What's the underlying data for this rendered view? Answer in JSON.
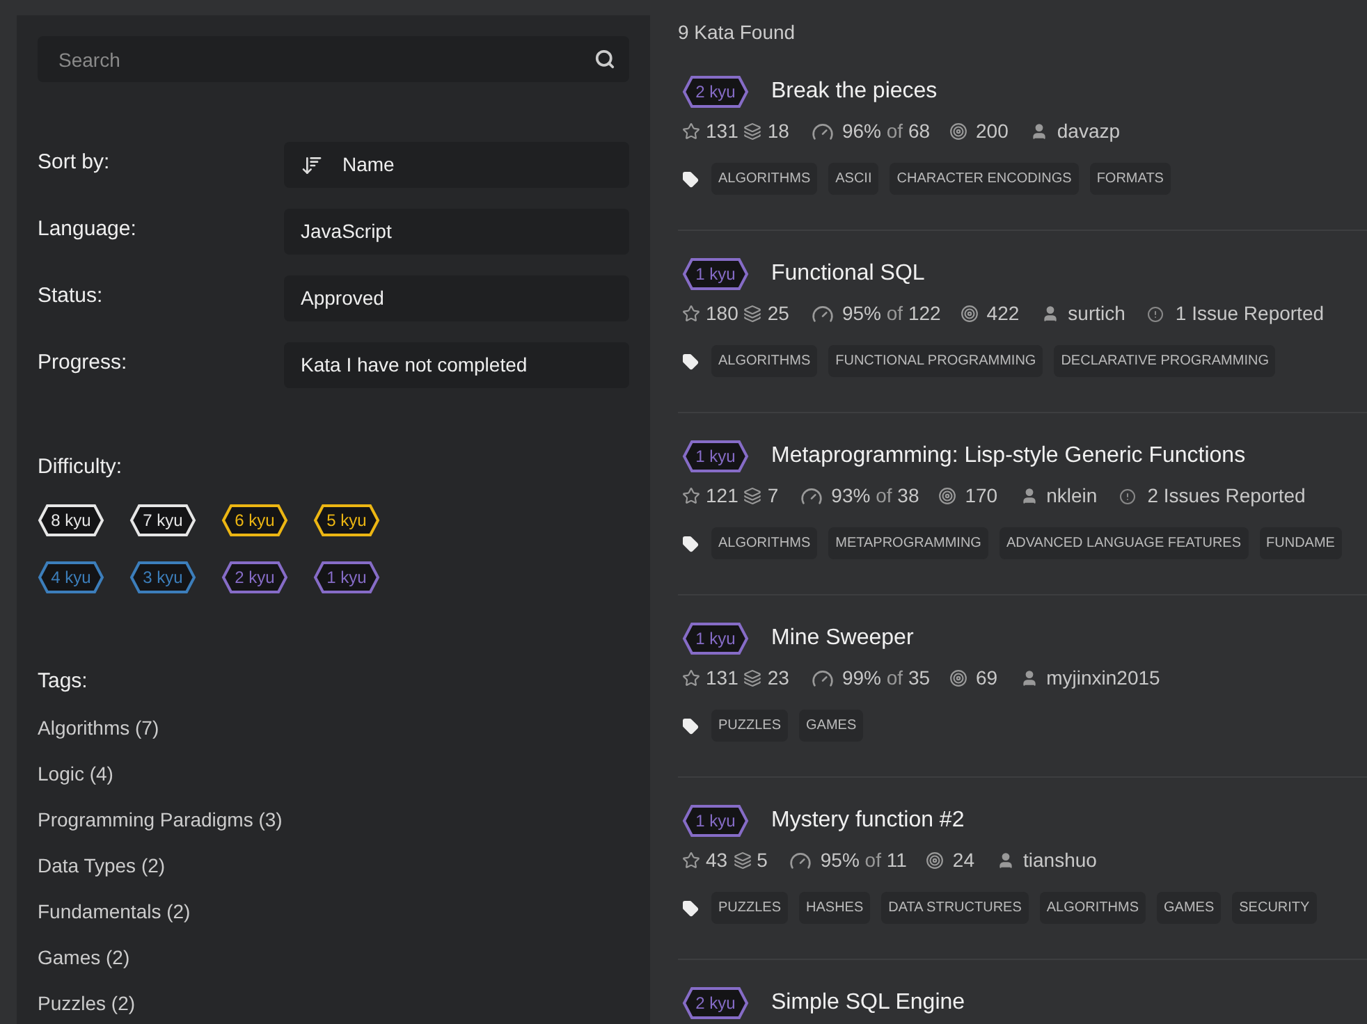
{
  "sidebar": {
    "search": {
      "placeholder": "Search"
    },
    "filters": [
      {
        "label": "Sort by:",
        "value": "Name",
        "kind": "sort"
      },
      {
        "label": "Language:",
        "value": "JavaScript",
        "kind": "select"
      },
      {
        "label": "Status:",
        "value": "Approved",
        "kind": "select"
      },
      {
        "label": "Progress:",
        "value": "Kata I have not completed",
        "kind": "select"
      }
    ],
    "difficulty": {
      "label": "Difficulty:",
      "ranks": [
        {
          "label": "8 kyu",
          "color": "#e6e6e6"
        },
        {
          "label": "7 kyu",
          "color": "#e6e6e6"
        },
        {
          "label": "6 kyu",
          "color": "#ecb613"
        },
        {
          "label": "5 kyu",
          "color": "#ecb613"
        },
        {
          "label": "4 kyu",
          "color": "#3c7ebb"
        },
        {
          "label": "3 kyu",
          "color": "#3c7ebb"
        },
        {
          "label": "2 kyu",
          "color": "#866cc7"
        },
        {
          "label": "1 kyu",
          "color": "#866cc7"
        }
      ]
    },
    "tags": {
      "label": "Tags:",
      "items": [
        "Algorithms (7)",
        "Logic (4)",
        "Programming Paradigms (3)",
        "Data Types (2)",
        "Fundamentals (2)",
        "Games (2)",
        "Puzzles (2)"
      ]
    }
  },
  "results": {
    "count": "9 Kata Found",
    "katas": [
      {
        "rank": "2 kyu",
        "color": "#866cc7",
        "title": "Break the pieces",
        "stars": "131",
        "collections": "18",
        "satisfaction": "96%",
        "of": "of",
        "votes": "68",
        "completions": "200",
        "author": "davazp",
        "tags": [
          "ALGORITHMS",
          "ASCII",
          "CHARACTER ENCODINGS",
          "FORMATS"
        ]
      },
      {
        "rank": "1 kyu",
        "color": "#866cc7",
        "title": "Functional SQL",
        "stars": "180",
        "collections": "25",
        "satisfaction": "95%",
        "of": "of",
        "votes": "122",
        "completions": "422",
        "author": "surtich",
        "issues": "1 Issue Reported",
        "tags": [
          "ALGORITHMS",
          "FUNCTIONAL PROGRAMMING",
          "DECLARATIVE PROGRAMMING"
        ]
      },
      {
        "rank": "1 kyu",
        "color": "#866cc7",
        "title": "Metaprogramming: Lisp-style Generic Functions",
        "stars": "121",
        "collections": "7",
        "satisfaction": "93%",
        "of": "of",
        "votes": "38",
        "completions": "170",
        "author": "nklein",
        "issues": "2 Issues Reported",
        "tags": [
          "ALGORITHMS",
          "METAPROGRAMMING",
          "ADVANCED LANGUAGE FEATURES",
          "FUNDAME"
        ]
      },
      {
        "rank": "1 kyu",
        "color": "#866cc7",
        "title": "Mine Sweeper",
        "stars": "131",
        "collections": "23",
        "satisfaction": "99%",
        "of": "of",
        "votes": "35",
        "completions": "69",
        "author": "myjinxin2015",
        "tags": [
          "PUZZLES",
          "GAMES"
        ]
      },
      {
        "rank": "1 kyu",
        "color": "#866cc7",
        "title": "Mystery function #2",
        "stars": "43",
        "collections": "5",
        "satisfaction": "95%",
        "of": "of",
        "votes": "11",
        "completions": "24",
        "author": "tianshuo",
        "tags": [
          "PUZZLES",
          "HASHES",
          "DATA STRUCTURES",
          "ALGORITHMS",
          "GAMES",
          "SECURITY"
        ]
      },
      {
        "rank": "2 kyu",
        "color": "#866cc7",
        "title": "Simple SQL Engine"
      }
    ]
  }
}
